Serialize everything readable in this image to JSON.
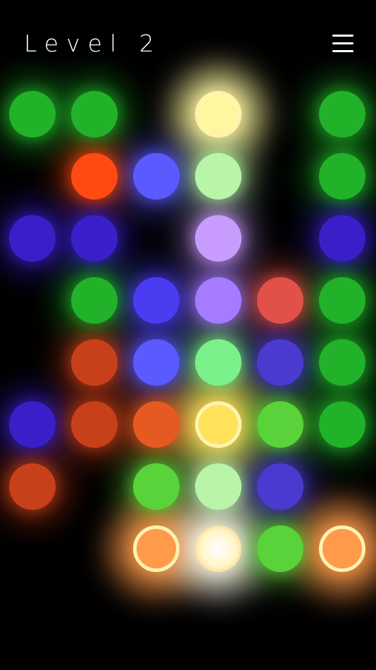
{
  "header": {
    "level_title": "Level 2",
    "menu_icon": "hamburger-menu-icon"
  },
  "colors": {
    "background": "#000000",
    "green": "#22b22a",
    "orange_red": "#ff4a12",
    "dark_orange": "#c8401a",
    "blue": "#4a3cf0",
    "indigo": "#3a1fc8",
    "light_blue": "#5a5aff",
    "lavender": "#c89cff",
    "violet": "#a57cff",
    "mint": "#7cf08a",
    "pale_green": "#b8f5a8",
    "lime": "#5ad23a",
    "yellow": "#ffe25a",
    "pale_yellow": "#fff7a0",
    "white_glow": "#fffbe8",
    "peach": "#ff9a4a",
    "coral": "#e2504a",
    "slate_blue": "#4a3ad0",
    "soft_orange": "#e65a22",
    "ring": "#fff3b0"
  },
  "grid": {
    "columns": 6,
    "rows": 8,
    "dots": [
      {
        "row": 0,
        "col": 0,
        "color": "green",
        "ringed": false
      },
      {
        "row": 0,
        "col": 1,
        "color": "green",
        "ringed": false
      },
      {
        "row": 0,
        "col": 3,
        "color": "pale_yellow",
        "ringed": true
      },
      {
        "row": 0,
        "col": 5,
        "color": "green",
        "ringed": false
      },
      {
        "row": 1,
        "col": 1,
        "color": "orange_red",
        "ringed": false
      },
      {
        "row": 1,
        "col": 2,
        "color": "light_blue",
        "ringed": false
      },
      {
        "row": 1,
        "col": 3,
        "color": "pale_green",
        "ringed": false
      },
      {
        "row": 1,
        "col": 5,
        "color": "green",
        "ringed": false
      },
      {
        "row": 2,
        "col": 0,
        "color": "indigo",
        "ringed": false
      },
      {
        "row": 2,
        "col": 1,
        "color": "indigo",
        "ringed": false
      },
      {
        "row": 2,
        "col": 3,
        "color": "lavender",
        "ringed": false
      },
      {
        "row": 2,
        "col": 5,
        "color": "indigo",
        "ringed": false
      },
      {
        "row": 3,
        "col": 1,
        "color": "green",
        "ringed": false
      },
      {
        "row": 3,
        "col": 2,
        "color": "blue",
        "ringed": false
      },
      {
        "row": 3,
        "col": 3,
        "color": "violet",
        "ringed": false
      },
      {
        "row": 3,
        "col": 4,
        "color": "coral",
        "ringed": false
      },
      {
        "row": 3,
        "col": 5,
        "color": "green",
        "ringed": false
      },
      {
        "row": 4,
        "col": 1,
        "color": "dark_orange",
        "ringed": false
      },
      {
        "row": 4,
        "col": 2,
        "color": "light_blue",
        "ringed": false
      },
      {
        "row": 4,
        "col": 3,
        "color": "mint",
        "ringed": false
      },
      {
        "row": 4,
        "col": 4,
        "color": "slate_blue",
        "ringed": false
      },
      {
        "row": 4,
        "col": 5,
        "color": "green",
        "ringed": false
      },
      {
        "row": 5,
        "col": 0,
        "color": "indigo",
        "ringed": false
      },
      {
        "row": 5,
        "col": 1,
        "color": "dark_orange",
        "ringed": false
      },
      {
        "row": 5,
        "col": 2,
        "color": "soft_orange",
        "ringed": false
      },
      {
        "row": 5,
        "col": 3,
        "color": "yellow",
        "ringed": true
      },
      {
        "row": 5,
        "col": 4,
        "color": "lime",
        "ringed": false
      },
      {
        "row": 5,
        "col": 5,
        "color": "green",
        "ringed": false
      },
      {
        "row": 6,
        "col": 0,
        "color": "dark_orange",
        "ringed": false
      },
      {
        "row": 6,
        "col": 2,
        "color": "lime",
        "ringed": false
      },
      {
        "row": 6,
        "col": 3,
        "color": "pale_green",
        "ringed": false
      },
      {
        "row": 6,
        "col": 4,
        "color": "slate_blue",
        "ringed": false
      },
      {
        "row": 7,
        "col": 2,
        "color": "peach",
        "ringed": true
      },
      {
        "row": 7,
        "col": 3,
        "color": "white_glow",
        "ringed": false
      },
      {
        "row": 7,
        "col": 4,
        "color": "lime",
        "ringed": false
      },
      {
        "row": 7,
        "col": 5,
        "color": "peach",
        "ringed": true
      }
    ]
  }
}
